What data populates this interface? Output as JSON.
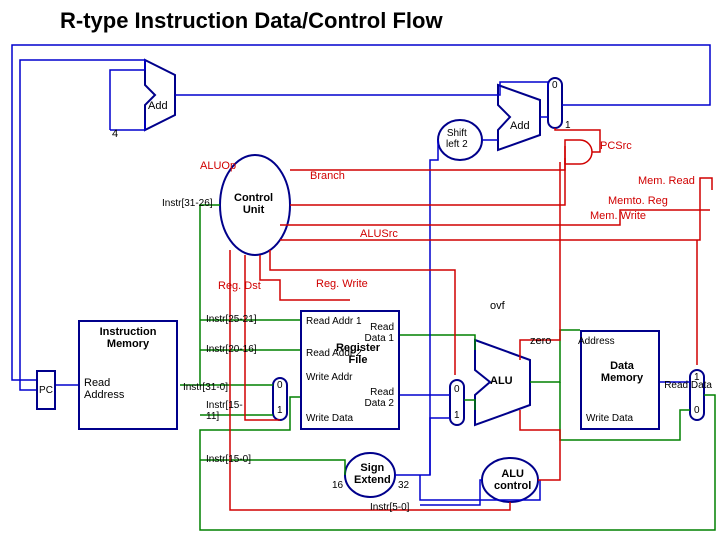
{
  "title": "R-type Instruction Data/Control Flow",
  "components": {
    "pc": "PC",
    "instr_mem": "Instruction\nMemory",
    "read_addr": "Read\nAddress",
    "instr_out": "Instr[31-0]",
    "add_top": "Add",
    "add_right": "Add",
    "const4": "4",
    "shift_left": "Shift\nleft 2",
    "control_unit": "Control\nUnit",
    "reg_file": "Register\nFile",
    "read_addr1": "Read Addr 1",
    "read_addr2": "Read Addr 2",
    "write_addr": "Write Addr",
    "write_data_reg": "Write Data",
    "read_data1": "Read\nData 1",
    "read_data2": "Read\nData 2",
    "alu": "ALU",
    "alu_control": "ALU\ncontrol",
    "sign_extend": "Sign\nExtend",
    "data_mem": "Data\nMemory",
    "address": "Address",
    "write_data_mem": "Write Data",
    "read_data_mem": "Read Data",
    "ovf": "ovf",
    "zero": "zero",
    "se_16": "16",
    "se_32": "32",
    "mux0a": "0",
    "mux1a": "1",
    "mux0b": "0",
    "mux1b": "1",
    "mux0c": "0",
    "mux1c": "1",
    "mux0d": "0",
    "mux1d": "1"
  },
  "signals": {
    "aluop": "ALUOp",
    "branch": "Branch",
    "reg_dst": "Reg. Dst",
    "alusrc": "ALUSrc",
    "reg_write": "Reg. Write",
    "mem_read": "Mem. Read",
    "mem_write": "Mem. Write",
    "memto_reg": "Memto. Reg",
    "pcsrc": "PCSrc"
  },
  "fields": {
    "f31_26": "Instr[31-26]",
    "f25_21": "Instr[25-21]",
    "f20_16": "Instr[20-16]",
    "f15_11": "Instr[15-11]",
    "f15_0": "Instr[15-0]",
    "f5_0": "Instr[5-0]"
  }
}
